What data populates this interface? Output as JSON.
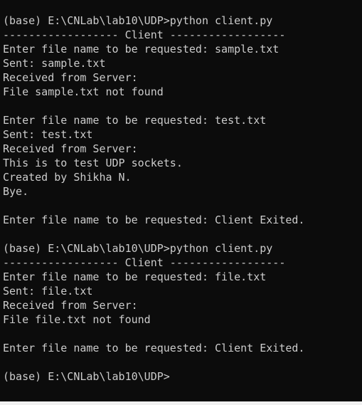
{
  "terminal": {
    "background": "#0c0c0c",
    "foreground": "#cccccc",
    "lines": [
      "(base) E:\\CNLab\\lab10\\UDP>python client.py",
      "------------------ Client ------------------",
      "Enter file name to be requested: sample.txt",
      "Sent: sample.txt",
      "Received from Server:",
      "File sample.txt not found",
      "",
      "Enter file name to be requested: test.txt",
      "Sent: test.txt",
      "Received from Server:",
      "This is to test UDP sockets.",
      "Created by Shikha N.",
      "Bye.",
      "",
      "Enter file name to be requested: Client Exited.",
      "",
      "(base) E:\\CNLab\\lab10\\UDP>python client.py",
      "------------------ Client ------------------",
      "Enter file name to be requested: file.txt",
      "Sent: file.txt",
      "Received from Server:",
      "File file.txt not found",
      "",
      "Enter file name to be requested: Client Exited.",
      "",
      "(base) E:\\CNLab\\lab10\\UDP>"
    ]
  }
}
